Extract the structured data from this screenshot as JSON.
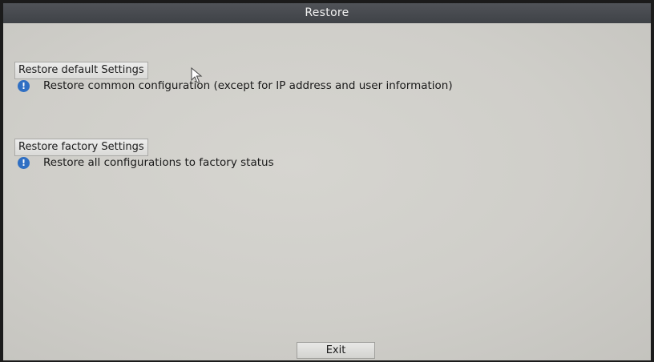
{
  "window": {
    "title": "Restore"
  },
  "sections": [
    {
      "button_label": "Restore default Settings",
      "info_icon": "info-circle-icon",
      "description": "Restore common configuration (except for IP address and user information)"
    },
    {
      "button_label": "Restore factory Settings",
      "info_icon": "info-circle-icon",
      "description": "Restore all configurations to factory status"
    }
  ],
  "footer": {
    "exit_label": "Exit"
  },
  "colors": {
    "title_bar": "#45484d",
    "background": "#d0cfca",
    "info_icon": "#2f6fc3"
  }
}
